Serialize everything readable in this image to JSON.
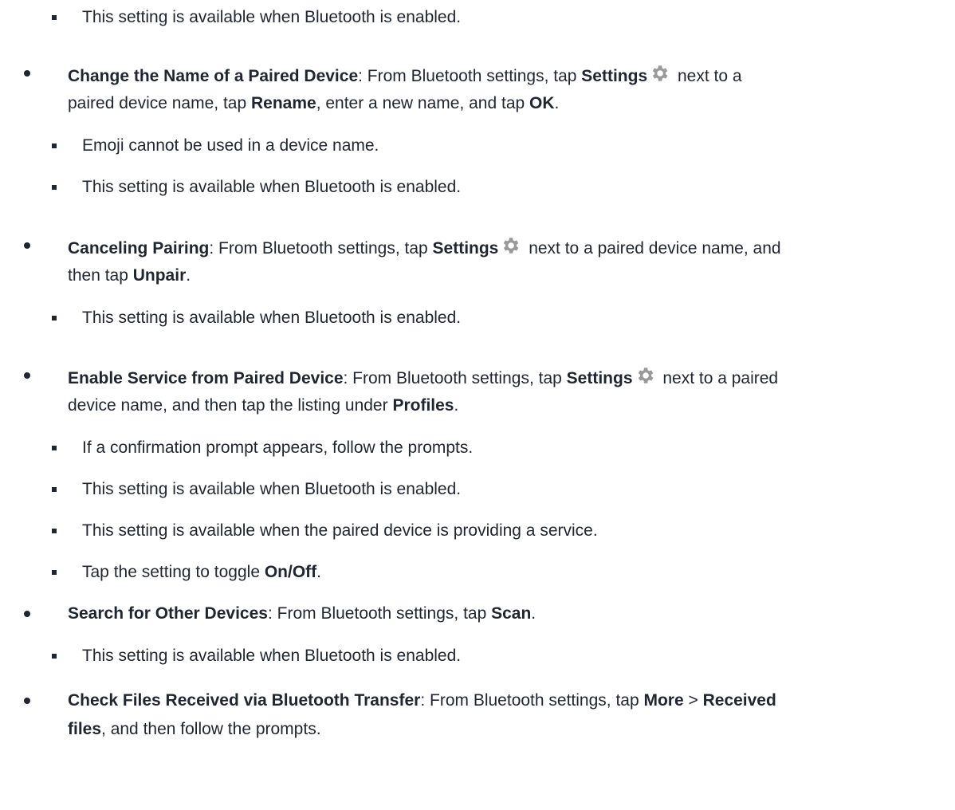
{
  "sections": [
    {
      "id": "top",
      "subitems": [
        "This setting is available when Bluetooth is enabled."
      ]
    },
    {
      "id": "rename",
      "title": "Change the Name of a Paired Device",
      "line1": {
        "a": ": From Bluetooth settings, tap ",
        "b": "Settings",
        "c": " next to a"
      },
      "line2": {
        "a": "paired device name, tap ",
        "b": "Rename",
        "c": ", enter a new name, and tap ",
        "d": "OK",
        "e": "."
      },
      "subitems": [
        "Emoji cannot be used in a device name.",
        "This setting is available when Bluetooth is enabled."
      ]
    },
    {
      "id": "unpair",
      "title": "Canceling Pairing",
      "line1": {
        "a": ": From Bluetooth settings, tap ",
        "b": "Settings",
        "c": " next to a paired device name, and"
      },
      "line2": {
        "a": "then tap ",
        "b": "Unpair",
        "c": "."
      },
      "subitems": [
        "This setting is available when Bluetooth is enabled."
      ]
    },
    {
      "id": "service",
      "title": "Enable Service from Paired Device",
      "line1": {
        "a": ": From Bluetooth settings, tap ",
        "b": "Settings",
        "c": " next to a paired"
      },
      "line2": {
        "a": "device name, and then tap the listing under ",
        "b": "Profiles",
        "c": "."
      },
      "subitems": [
        "If a confirmation prompt appears, follow the prompts.",
        "This setting is available when Bluetooth is enabled.",
        "This setting is available when the paired device is providing a service."
      ],
      "toggle_item": {
        "a": "Tap the setting to toggle ",
        "b": "On/Off",
        "c": "."
      }
    },
    {
      "id": "scan",
      "title": "Search for Other Devices",
      "line1": {
        "a": ": From Bluetooth settings, tap ",
        "b": "Scan",
        "c": "."
      },
      "subitems": [
        "This setting is available when Bluetooth is enabled."
      ]
    },
    {
      "id": "received",
      "title": "Check Files Received via Bluetooth Transfer",
      "line1": {
        "a": ": From Bluetooth settings, tap ",
        "b": "More",
        "c": " > ",
        "d": "Received"
      },
      "line2": {
        "a": "files",
        "b": ", and then follow the prompts."
      }
    }
  ],
  "colors": {
    "text": "#1f2630",
    "gear_icon": "#9a9a9a"
  }
}
